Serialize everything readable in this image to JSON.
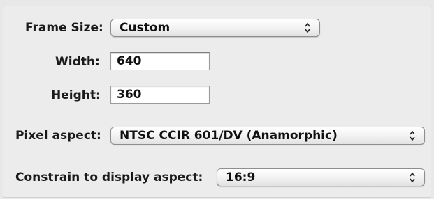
{
  "frame_size": {
    "label": "Frame Size:",
    "value": "Custom"
  },
  "width": {
    "label": "Width:",
    "value": "640"
  },
  "height": {
    "label": "Height:",
    "value": "360"
  },
  "pixel_aspect": {
    "label": "Pixel aspect:",
    "value": "NTSC CCIR 601/DV (Anamorphic)"
  },
  "constrain": {
    "label": "Constrain to display aspect:",
    "value": "16:9"
  },
  "icons": {
    "popup_arrows": "up-down-chevron-icon"
  }
}
